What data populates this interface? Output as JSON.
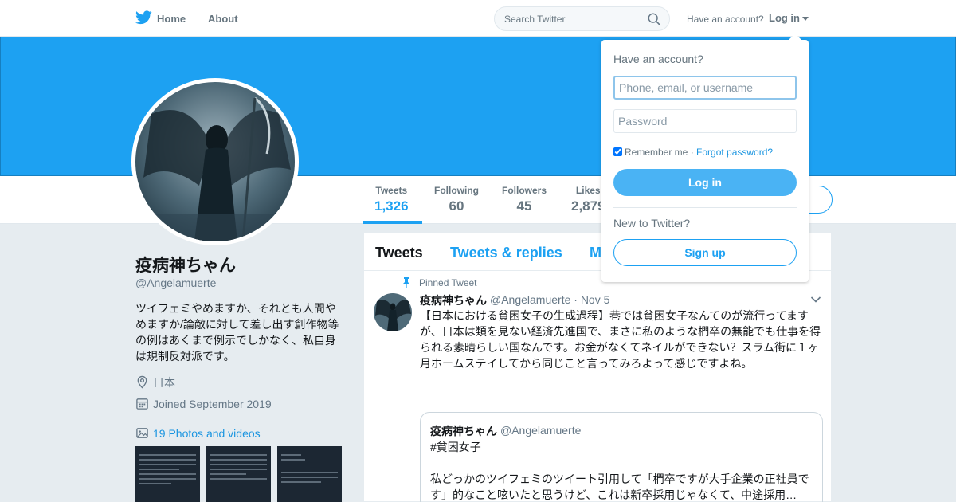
{
  "nav": {
    "home": "Home",
    "about": "About",
    "search_placeholder": "Search Twitter",
    "have_account": "Have an account?",
    "login": "Log in"
  },
  "stats": [
    {
      "label": "Tweets",
      "value": "1,326"
    },
    {
      "label": "Following",
      "value": "60"
    },
    {
      "label": "Followers",
      "value": "45"
    },
    {
      "label": "Likes",
      "value": "2,879"
    }
  ],
  "profile": {
    "name": "疫病神ちゃん",
    "handle": "@Angelamuerte",
    "bio": "ツイフェミやめますか、それとも人間やめますか/論敵に対して差し出す創作物等の例はあくまで例示でしかなく、私自身は規制反対派です。",
    "location": "日本",
    "joined": "Joined September 2019",
    "photos": "19 Photos and videos"
  },
  "tabs": {
    "tweets": "Tweets",
    "replies": "Tweets & replies",
    "media": "M"
  },
  "tweet": {
    "pinned": "Pinned Tweet",
    "name": "疫病神ちゃん",
    "handle_date": "@Angelamuerte · Nov 5",
    "text": "【日本における貧困女子の生成過程】巷では貧困女子なんてのが流行ってますが、日本は類を見ない経済先進国で、まさに私のような椚卒の無能でも仕事を得られる素晴らしい国なんです。お金がなくてネイルができない？スラム街に１ヶ月ホームステイしてから同じこと言ってみろよって感じですよね。",
    "quote": {
      "name": "疫病神ちゃん",
      "handle": "@Angelamuerte",
      "text": "#貧困女子\n\n私どっかのツイフェミのツイート引用して「椚卒ですが大手企業の正社員です」的なこと呟いたと思うけど、これは新卒採用じゃなくて、中途採用…"
    }
  },
  "login_dropdown": {
    "title": "Have an account?",
    "username_placeholder": "Phone, email, or username",
    "password_placeholder": "Password",
    "remember": "Remember me",
    "separator": " · ",
    "forgot": "Forgot password?",
    "login_button": "Log in",
    "new_to": "New to Twitter?",
    "signup": "Sign up"
  },
  "colors": {
    "brand": "#1da1f2",
    "link": "#1b95e0",
    "muted": "#657786",
    "background": "#e6ecf0"
  },
  "icons": [
    "twitter-bird-icon",
    "search-icon",
    "location-icon",
    "calendar-icon",
    "photo-icon",
    "pin-icon",
    "chevron-down-icon"
  ]
}
